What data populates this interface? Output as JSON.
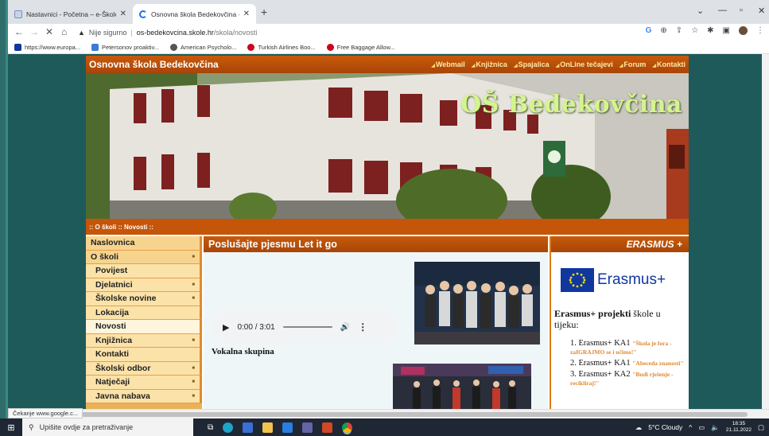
{
  "browser": {
    "tabs": [
      {
        "title": "Nastavnici - Početna – e-Škole",
        "active": false
      },
      {
        "title": "Osnovna škola Bedekovčina - No",
        "active": true
      }
    ],
    "address": {
      "security_label": "Nije sigurno",
      "host": "os-bedekovcina.skole.hr",
      "path": "/skola/novosti"
    },
    "bookmarks": [
      "https://www.europa...",
      "Petersonov proaktiv...",
      "American Psycholo...",
      "Turkish Airlines Boo...",
      "Free Baggage Allow..."
    ],
    "status_text": "Čekanje www.google.c..."
  },
  "site": {
    "title": "Osnovna škola Bedekovčina",
    "top_nav": [
      "Webmail",
      "Knjižnica",
      "Spajalica",
      "OnLine tečajevi",
      "Forum",
      "Kontakti"
    ],
    "banner_text": "OŠ Bedekovčina",
    "breadcrumb": ":: O školi :: Novosti ::",
    "menu": [
      {
        "label": "Naslovnica",
        "sub": false,
        "arrow": false
      },
      {
        "label": "O školi",
        "sub": false,
        "arrow": true
      },
      {
        "label": "Povijest",
        "sub": true,
        "arrow": false
      },
      {
        "label": "Djelatnici",
        "sub": true,
        "arrow": true
      },
      {
        "label": "Školske novine",
        "sub": true,
        "arrow": true
      },
      {
        "label": "Lokacija",
        "sub": true,
        "arrow": false
      },
      {
        "label": "Novosti",
        "sub": true,
        "arrow": false,
        "active": true
      },
      {
        "label": "Knjižnica",
        "sub": true,
        "arrow": true
      },
      {
        "label": "Kontakti",
        "sub": true,
        "arrow": false
      },
      {
        "label": "Školski odbor",
        "sub": true,
        "arrow": true
      },
      {
        "label": "Natječaji",
        "sub": true,
        "arrow": true
      },
      {
        "label": "Javna nabava",
        "sub": true,
        "arrow": true
      }
    ],
    "article": {
      "title": "Poslušajte pjesmu Let it go",
      "audio_time": "0:00 / 3:01",
      "caption": "Vokalna skupina"
    },
    "right": {
      "title": "ERASMUS +",
      "logo_text": "Erasmus+",
      "intro_bold": "Erasmus+ projekti",
      "intro_rest": " škole u tijeku:",
      "projects": [
        {
          "name": "Erasmus+ KA1",
          "quote": "\"Škola je fora - zaIGRAJMO se i učimo!\""
        },
        {
          "name": "Erasmus+ KA1",
          "quote": "\"Abeceda znanosti\""
        },
        {
          "name": "Erasmus+ KA2",
          "quote": "\"Budi rješenje - recikliraj!\""
        }
      ]
    }
  },
  "taskbar": {
    "search_placeholder": "Upišite ovdje za pretraživanje",
    "weather": "5°C  Cloudy",
    "time": "18:35",
    "date": "21.11.2022"
  }
}
